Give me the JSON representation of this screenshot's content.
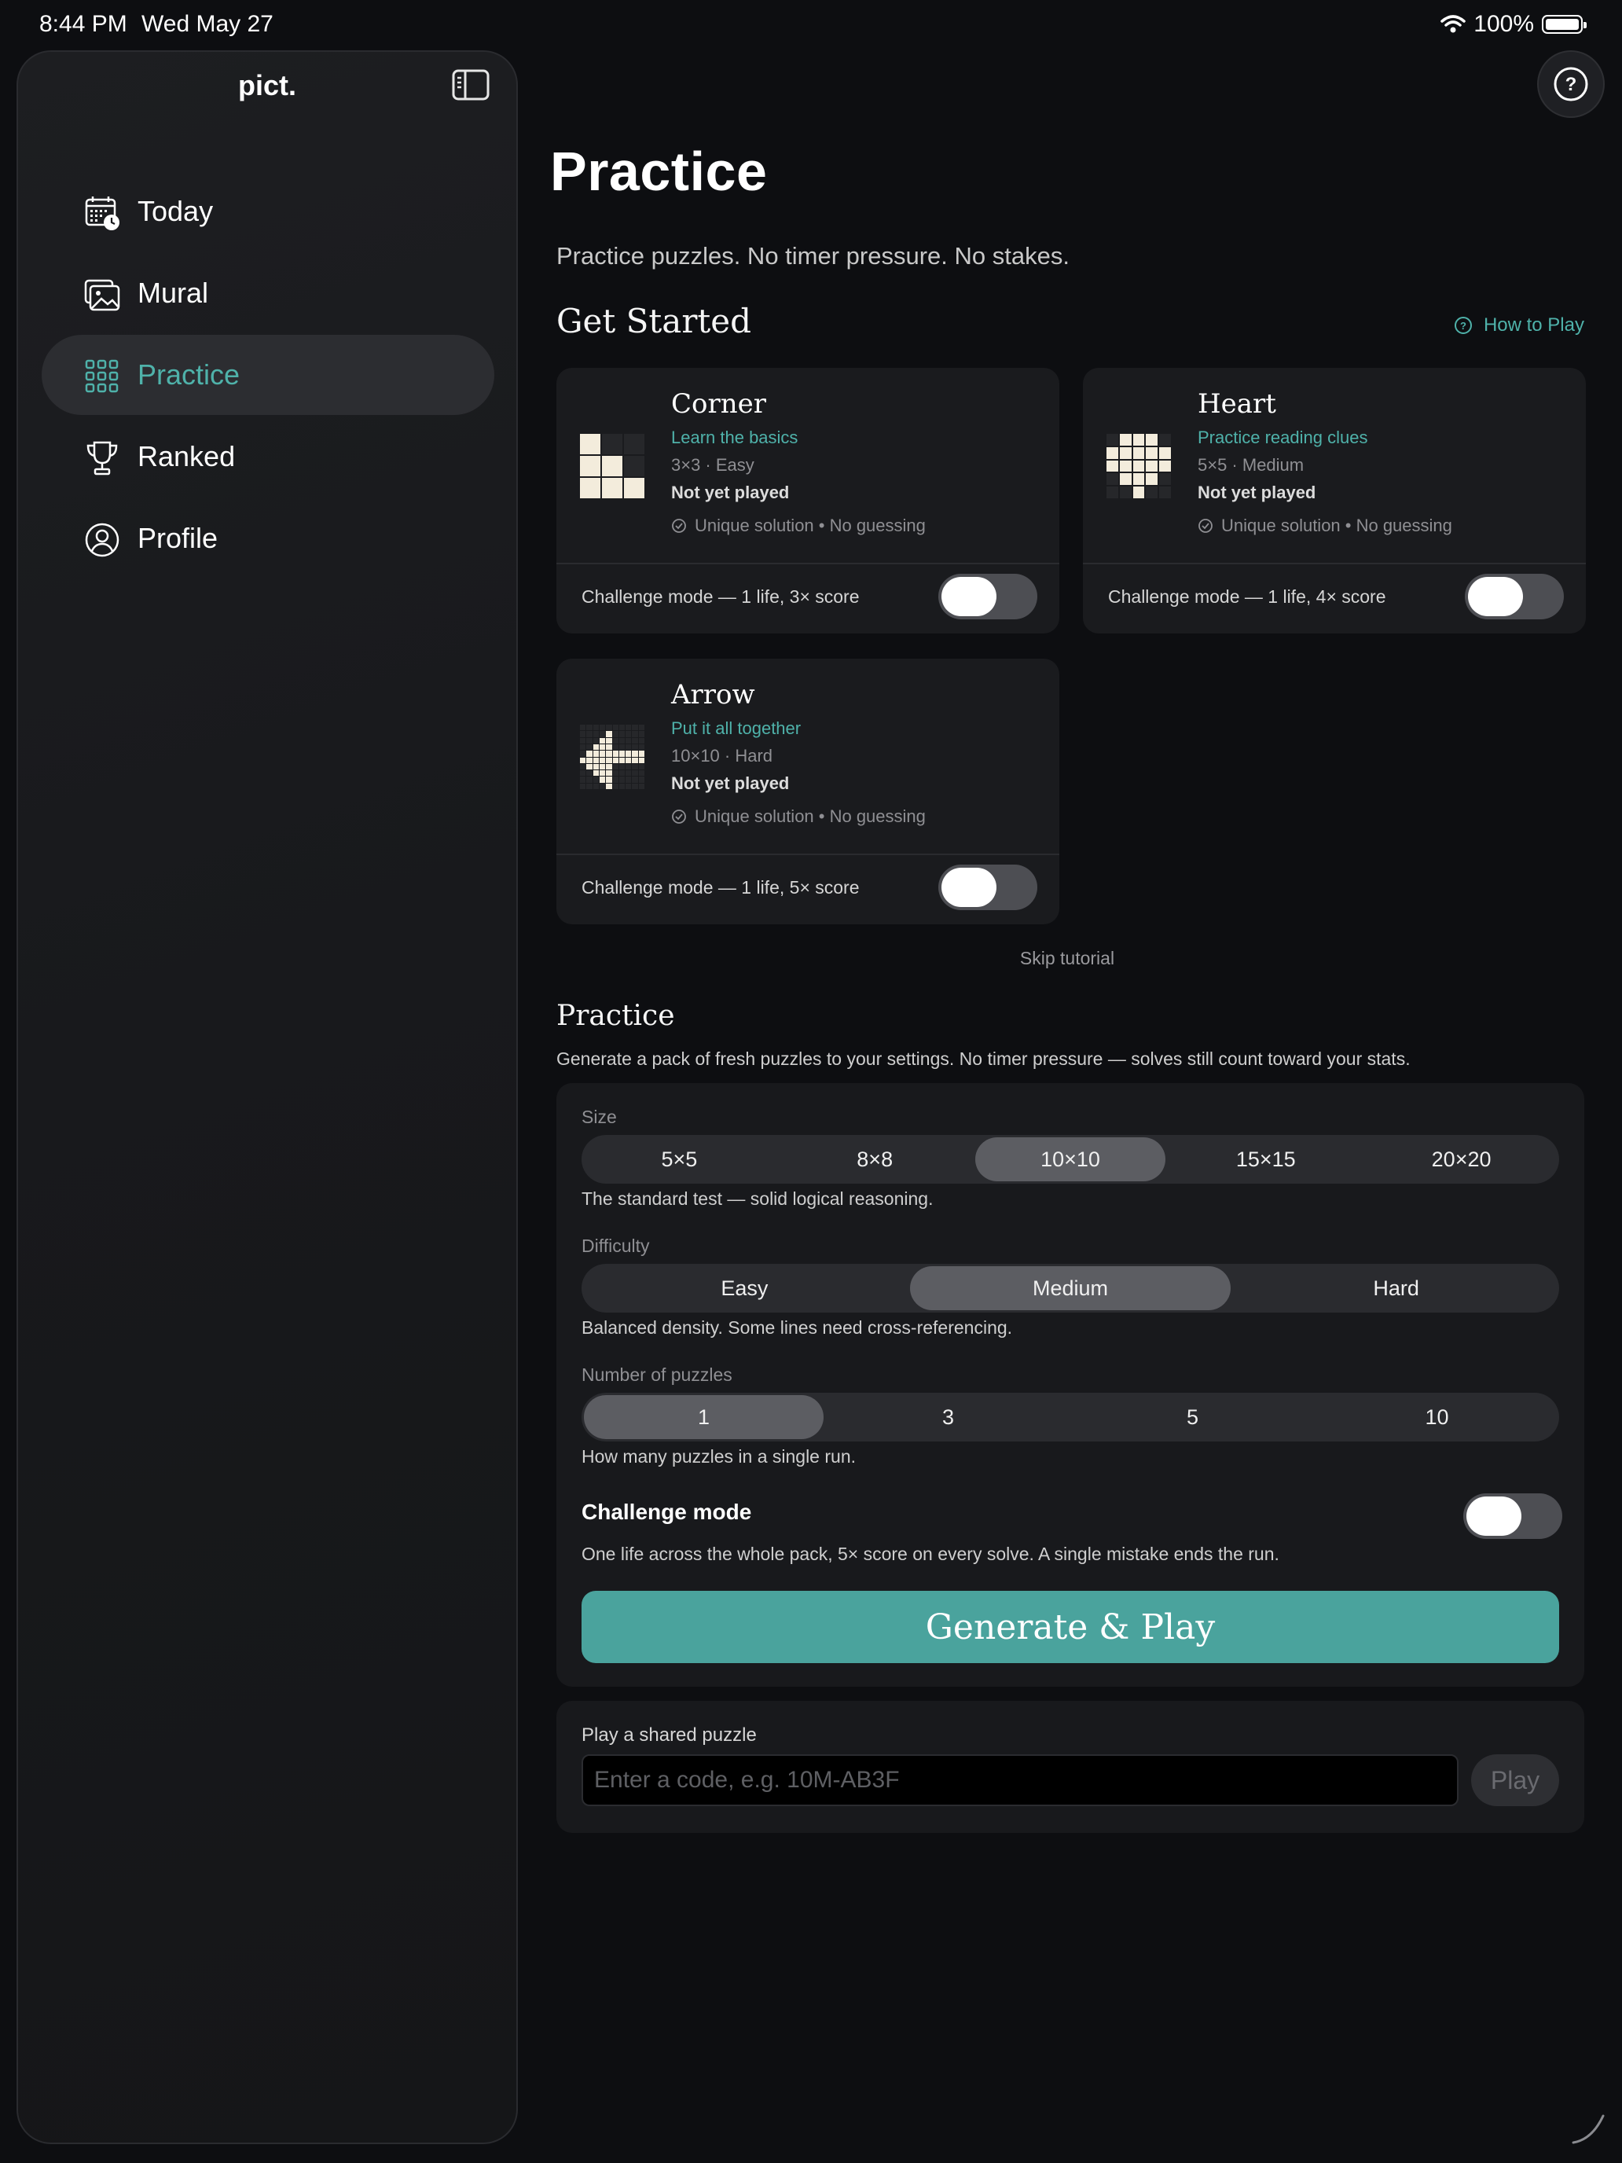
{
  "status_bar": {
    "time": "8:44 PM",
    "date": "Wed May 27",
    "battery": "100%"
  },
  "sidebar": {
    "brand": "pict.",
    "items": [
      {
        "label": "Today",
        "icon": "calendar-clock-icon"
      },
      {
        "label": "Mural",
        "icon": "photos-icon"
      },
      {
        "label": "Practice",
        "icon": "grid-icon",
        "active": true
      },
      {
        "label": "Ranked",
        "icon": "trophy-icon"
      },
      {
        "label": "Profile",
        "icon": "person-circle-icon"
      }
    ]
  },
  "header": {
    "title": "Practice",
    "subtitle": "Practice puzzles. No timer pressure. No stakes."
  },
  "get_started": {
    "title": "Get Started",
    "how_to_play": "How to Play",
    "cards": [
      {
        "title": "Corner",
        "tagline": "Learn the basics",
        "meta": "3×3 · Easy",
        "status": "Not yet played",
        "features": "Unique solution • No guessing",
        "challenge": "Challenge mode — 1 life, 3× score",
        "challenge_on": false
      },
      {
        "title": "Heart",
        "tagline": "Practice reading clues",
        "meta": "5×5 · Medium",
        "status": "Not yet played",
        "features": "Unique solution • No guessing",
        "challenge": "Challenge mode — 1 life, 4× score",
        "challenge_on": false
      },
      {
        "title": "Arrow",
        "tagline": "Put it all together",
        "meta": "10×10 · Hard",
        "status": "Not yet played",
        "features": "Unique solution • No guessing",
        "challenge": "Challenge mode — 1 life, 5× score",
        "challenge_on": false
      }
    ],
    "skip": "Skip tutorial"
  },
  "practice": {
    "title": "Practice",
    "description": "Generate a pack of fresh puzzles to your settings. No timer pressure — solves still count toward your stats.",
    "size": {
      "label": "Size",
      "options": [
        "5×5",
        "8×8",
        "10×10",
        "15×15",
        "20×20"
      ],
      "selected": "10×10",
      "help": "The standard test — solid logical reasoning."
    },
    "difficulty": {
      "label": "Difficulty",
      "options": [
        "Easy",
        "Medium",
        "Hard"
      ],
      "selected": "Medium",
      "help": "Balanced density. Some lines need cross-referencing."
    },
    "count": {
      "label": "Number of puzzles",
      "options": [
        "1",
        "3",
        "5",
        "10"
      ],
      "selected": "1",
      "help": "How many puzzles in a single run."
    },
    "challenge": {
      "label": "Challenge mode",
      "help": "One life across the whole pack, 5× score on every solve. A single mistake ends the run.",
      "on": false
    },
    "generate": "Generate & Play"
  },
  "shared": {
    "label": "Play a shared puzzle",
    "placeholder": "Enter a code, e.g. 10M-AB3F",
    "value": "",
    "play": "Play"
  },
  "colors": {
    "accent": "#4fb2aa",
    "button": "#4aa39d",
    "background": "#0d0e11",
    "card": "#1a1b1e"
  }
}
